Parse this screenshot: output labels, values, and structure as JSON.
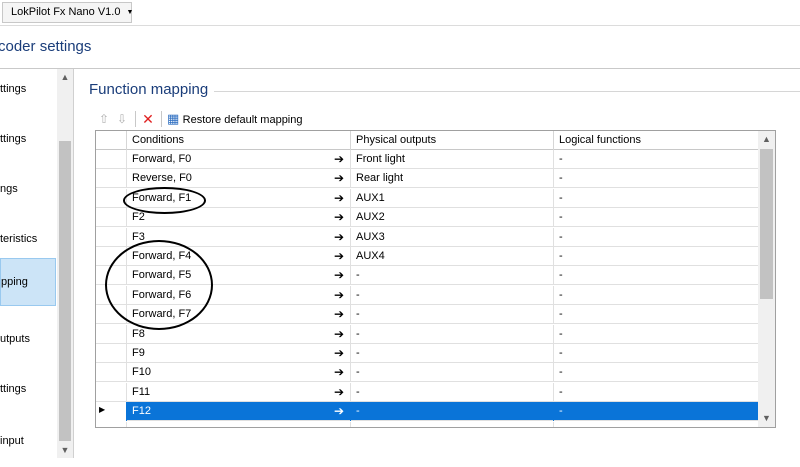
{
  "device": {
    "label": "LokPilot Fx Nano V1.0",
    "caret": "▼"
  },
  "page_title": "coder settings",
  "sidebar": {
    "items": [
      {
        "label": "ttings"
      },
      {
        "label": "ttings"
      },
      {
        "label": "ngs"
      },
      {
        "label": "teristics"
      },
      {
        "label": "pping"
      },
      {
        "label": "utputs"
      },
      {
        "label": "ttings"
      },
      {
        "label": "input"
      }
    ],
    "scroll_up": "▲",
    "scroll_down": "▼"
  },
  "group": {
    "title": "Function mapping"
  },
  "toolbar": {
    "up_icon": "⇧",
    "down_icon": "⇩",
    "delete_icon": "✕",
    "table_icon": "▦",
    "restore_label": "Restore default mapping"
  },
  "table": {
    "headers": [
      "Conditions",
      "Physical outputs",
      "Logical functions"
    ],
    "arrow": "➔",
    "selected_marker": "▶",
    "rows": [
      {
        "condition": "Forward, F0",
        "output": "Front light",
        "logical": "-"
      },
      {
        "condition": "Reverse, F0",
        "output": "Rear light",
        "logical": "-"
      },
      {
        "condition": "Forward, F1",
        "output": "AUX1",
        "logical": "-"
      },
      {
        "condition": "F2",
        "output": "AUX2",
        "logical": "-"
      },
      {
        "condition": "F3",
        "output": "AUX3",
        "logical": "-"
      },
      {
        "condition": "Forward, F4",
        "output": "AUX4",
        "logical": "-"
      },
      {
        "condition": "Forward, F5",
        "output": "-",
        "logical": "-"
      },
      {
        "condition": "Forward, F6",
        "output": "-",
        "logical": "-"
      },
      {
        "condition": "Forward, F7",
        "output": "-",
        "logical": "-"
      },
      {
        "condition": "F8",
        "output": "-",
        "logical": "-"
      },
      {
        "condition": "F9",
        "output": "-",
        "logical": "-"
      },
      {
        "condition": "F10",
        "output": "-",
        "logical": "-"
      },
      {
        "condition": "F11",
        "output": "-",
        "logical": "-"
      },
      {
        "condition": "F12",
        "output": "-",
        "logical": "-"
      },
      {
        "condition": "",
        "output": "",
        "logical": ""
      }
    ],
    "selected_row": 13,
    "scroll_up": "▲",
    "scroll_down": "▼"
  },
  "colors": {
    "selection": "#0a74d8",
    "title": "#1a3d7a",
    "delete": "#e02020"
  }
}
